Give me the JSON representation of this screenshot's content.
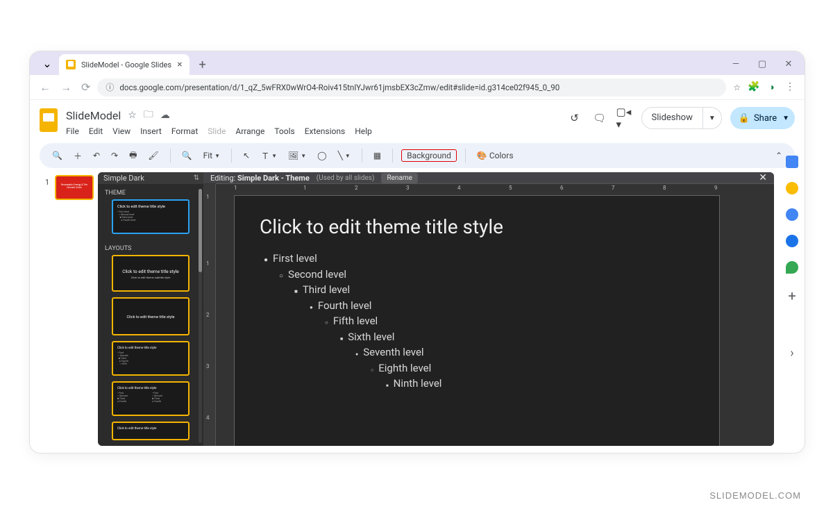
{
  "browser": {
    "tab_title": "SlideModel - Google Slides",
    "url": "docs.google.com/presentation/d/1_qZ_5wFRX0wWrO4-Roiv415tnIYJwr61jmsbEX3cZmw/edit#slide=id.g314ce02f945_0_90"
  },
  "app": {
    "doc_title": "SlideModel",
    "menus": [
      "File",
      "Edit",
      "View",
      "Insert",
      "Format",
      "Slide",
      "Arrange",
      "Tools",
      "Extensions",
      "Help"
    ],
    "disabled_menu": "Slide",
    "slideshow_label": "Slideshow",
    "share_label": "Share"
  },
  "toolbar": {
    "zoom_label": "Fit",
    "background_label": "Background",
    "colors_label": "Colors"
  },
  "theme_panel": {
    "title": "Simple Dark",
    "theme_label": "THEME",
    "layouts_label": "LAYOUTS",
    "thumb_title": "Click to edit theme title style",
    "thumb_subtitle": "Click to edit theme subtitle style"
  },
  "editor": {
    "editing_prefix": "Editing: ",
    "theme_name": "Simple Dark - Theme",
    "used_by": "(Used by all slides)",
    "rename_label": "Rename"
  },
  "slide": {
    "title": "Click to edit theme title style",
    "levels": [
      "First level",
      "Second level",
      "Third level",
      "Fourth level",
      "Fifth level",
      "Sixth level",
      "Seventh level",
      "Eighth level",
      "Ninth level"
    ],
    "hash": "#"
  },
  "filmstrip": {
    "num": "1",
    "thumb_text": "Renewable Energy & The Climate Crisis"
  },
  "ruler": {
    "h": [
      "1",
      "",
      "1",
      "2",
      "3",
      "4",
      "5",
      "6",
      "7",
      "8",
      "9"
    ],
    "v": [
      "1",
      "",
      "1",
      "2",
      "3",
      "4"
    ]
  },
  "watermark": "SLIDEMODEL.COM"
}
